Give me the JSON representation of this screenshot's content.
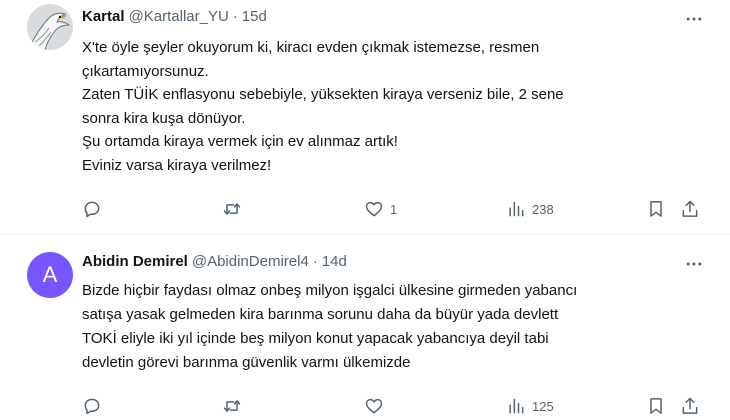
{
  "tweets": [
    {
      "name": "Kartal",
      "handle": "@Kartallar_YU",
      "separator": "·",
      "time": "15d",
      "lines": [
        "X'te öyle şeyler okuyorum ki, kiracı evden çıkmak istemezse, resmen",
        "çıkartamıyorsunuz.",
        "Zaten TÜİK enflasyonu sebebiyle, yüksekten kiraya verseniz bile, 2 sene",
        "sonra kira kuşa dönüyor.",
        "Şu ortamda kiraya vermek için ev alınmaz artık!",
        "Eviniz varsa kiraya verilmez!"
      ],
      "likes": "1",
      "views": "238"
    },
    {
      "name": "Abidin Demirel",
      "avatar_letter": "A",
      "handle": "@AbidinDemirel4",
      "separator": "·",
      "time": "14d",
      "lines": [
        "Bizde hiçbir faydası olmaz onbeş milyon işgalci ülkesine girmeden yabancı",
        "satışa yasak gelmeden kira barınma sorunu daha da büyür yada devlett",
        "TOKİ eliyle iki yıl içinde beş milyon konut yapacak  yabancıya deyil tabi",
        "devletin görevi barınma güvenlik varmı ülkemizde"
      ],
      "views": "125"
    }
  ],
  "icons": {
    "reply": "reply-icon",
    "retweet": "retweet-icon",
    "like": "heart-icon",
    "views": "views-icon",
    "bookmark": "bookmark-icon",
    "share": "share-icon",
    "more": "more-icon"
  },
  "colors": {
    "text": "#0f1419",
    "secondary": "#536471",
    "avatar_purple": "#7856ff",
    "divider": "#eff3f4"
  }
}
